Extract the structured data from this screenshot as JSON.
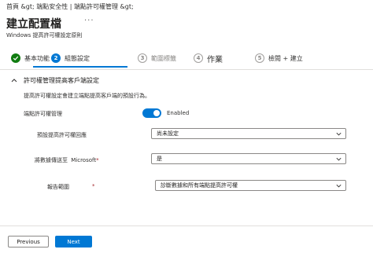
{
  "header": {
    "breadcrumb": "首頁 &gt; 端點安全性 | 端點許可權管理 &gt;",
    "title": "建立配置檔",
    "more_label": "...",
    "subtitle": "Windows 提高許可權設定原則"
  },
  "wizard": {
    "steps": [
      {
        "number": "",
        "label": "基本功能",
        "state": "done"
      },
      {
        "number": "2",
        "label": "組態設定",
        "state": "current"
      },
      {
        "number": "3",
        "label": "範圍標籤",
        "state": "future"
      },
      {
        "number": "4",
        "label": "作業",
        "state": "future"
      },
      {
        "number": "5",
        "label": "檢閱 + 建立",
        "state": "future"
      }
    ]
  },
  "section": {
    "title": "許可權管理提高客戶端設定",
    "description": "提高許可權設定會建立端點提高客戶端的預設行為。"
  },
  "form": {
    "epm": {
      "label": "端點許可權管理",
      "toggle_value": "Enabled",
      "enabled": true
    },
    "default_response": {
      "label": "預設提高許可權回應",
      "value": "尚未設定"
    },
    "send_data": {
      "label_prefix": "將數據傳送至",
      "label_brand": "Microsoft",
      "required_mark": "*",
      "value": "是"
    },
    "reporting_scope": {
      "label": "報告範圍",
      "required_mark": "*",
      "value": "診斷數據和所有端點提高許可權"
    }
  },
  "footer": {
    "previous_label": "Previous",
    "next_label": "Next"
  },
  "colors": {
    "accent": "#0078d4",
    "success": "#107c10",
    "required": "#a4262c"
  },
  "icons": {
    "step_done": "checkmark-icon",
    "collapse": "chevron-up-icon",
    "dropdown": "chevron-down-icon"
  }
}
